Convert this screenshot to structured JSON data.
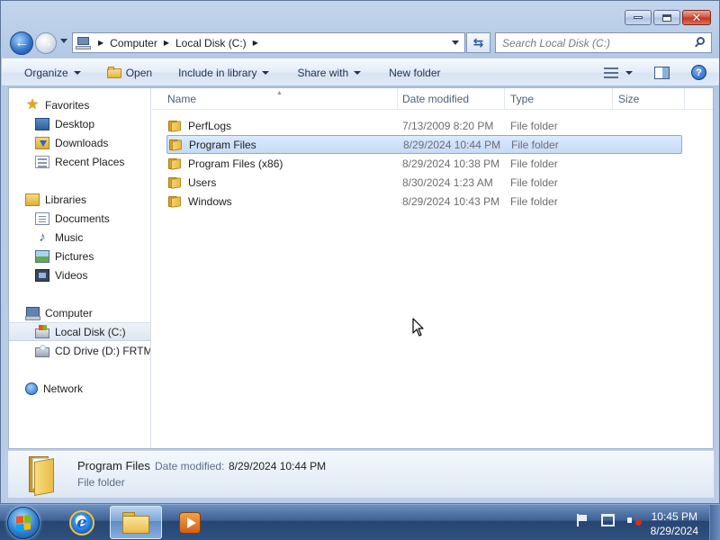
{
  "window": {
    "caption": {
      "minimize_glyph": "minimize-icon",
      "maximize_glyph": "maximize-icon",
      "close_glyph": "✕"
    }
  },
  "nav": {
    "back_glyph": "←",
    "forward_glyph": "→",
    "breadcrumbs": [
      "Computer",
      "Local Disk (C:)"
    ],
    "search_placeholder": "Search Local Disk (C:)"
  },
  "toolbar": {
    "organize": "Organize",
    "open": "Open",
    "include_in_library": "Include in library",
    "share_with": "Share with",
    "new_folder": "New folder",
    "help": "?"
  },
  "sidebar": {
    "favorites": "Favorites",
    "desktop": "Desktop",
    "downloads": "Downloads",
    "recent_places": "Recent Places",
    "libraries": "Libraries",
    "documents": "Documents",
    "music": "Music",
    "pictures": "Pictures",
    "videos": "Videos",
    "computer": "Computer",
    "local_disk": "Local Disk (C:)",
    "cd_drive": "CD Drive (D:) FRTME",
    "network": "Network"
  },
  "columns": {
    "name": "Name",
    "date_modified": "Date modified",
    "type": "Type",
    "size": "Size"
  },
  "files": [
    {
      "name": "PerfLogs",
      "date": "7/13/2009 8:20 PM",
      "type": "File folder"
    },
    {
      "name": "Program Files",
      "date": "8/29/2024 10:44 PM",
      "type": "File folder",
      "selected": true
    },
    {
      "name": "Program Files (x86)",
      "date": "8/29/2024 10:38 PM",
      "type": "File folder"
    },
    {
      "name": "Users",
      "date": "8/30/2024 1:23 AM",
      "type": "File folder"
    },
    {
      "name": "Windows",
      "date": "8/29/2024 10:43 PM",
      "type": "File folder"
    }
  ],
  "details": {
    "name": "Program Files",
    "date_label": "Date modified:",
    "date_value": "8/29/2024 10:44 PM",
    "type": "File folder"
  },
  "taskbar": {
    "time": "10:45 PM",
    "date": "8/29/2024",
    "ie_glyph": "e"
  },
  "colors": {
    "selection": "#cce4f7",
    "selection_border": "#84acdd",
    "taskbar": "#2f5283"
  }
}
